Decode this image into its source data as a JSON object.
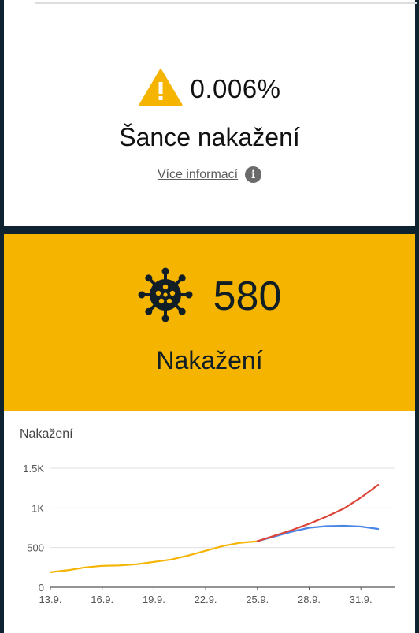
{
  "risk": {
    "value": "0.006%",
    "title": "Šance nakažení",
    "more_link": "Více informací",
    "warning_color": "#f4b400",
    "icons": [
      "warning-icon",
      "info-icon"
    ]
  },
  "infected": {
    "value": "580",
    "title": "Nakažení",
    "background_color": "#f4b400",
    "icon": "virus-icon"
  },
  "chart_data": {
    "type": "line",
    "title": "Nakažení",
    "x_labels": [
      "13.9.",
      "16.9.",
      "19.9.",
      "22.9.",
      "25.9.",
      "28.9.",
      "31.9."
    ],
    "y_ticks": [
      "0",
      "500",
      "1K",
      "1.5K"
    ],
    "ylim": [
      0,
      1500
    ],
    "grid": true,
    "series": [
      {
        "color": "#f4b400",
        "x": [
          0,
          1,
          2,
          3,
          4,
          5,
          6,
          7,
          8,
          9,
          10,
          11,
          12
        ],
        "values": [
          190,
          215,
          250,
          270,
          275,
          290,
          320,
          350,
          400,
          460,
          520,
          560,
          580
        ]
      },
      {
        "color": "#4a86e8",
        "x": [
          12,
          13,
          14,
          15,
          16,
          17,
          18,
          19
        ],
        "values": [
          580,
          640,
          700,
          750,
          770,
          775,
          765,
          735
        ]
      },
      {
        "color": "#db4437",
        "x": [
          12,
          13,
          14,
          15,
          16,
          17,
          18,
          19
        ],
        "values": [
          580,
          650,
          720,
          800,
          890,
          990,
          1130,
          1290
        ]
      }
    ]
  }
}
